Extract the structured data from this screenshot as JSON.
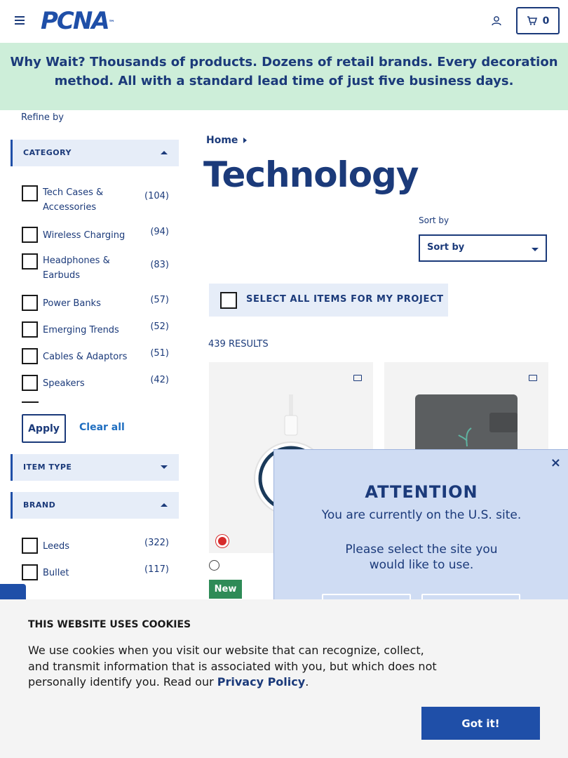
{
  "header": {
    "logo": "PCNA",
    "logo_mark": "™",
    "cart_count": "0"
  },
  "banner": {
    "lead": "Why Wait?",
    "text": " Thousands of products. Dozens of retail brands. Every decoration method. All with a standard lead time of just five business days."
  },
  "sidebar": {
    "refine_label": "Refine by",
    "category": {
      "title": "CATEGORY",
      "items": [
        {
          "label": "Tech Cases & Accessories",
          "count": "(104)"
        },
        {
          "label": "Wireless Charging",
          "count": "(94)"
        },
        {
          "label": "Headphones & Earbuds",
          "count": "(83)"
        },
        {
          "label": "Power Banks",
          "count": "(57)"
        },
        {
          "label": "Emerging Trends",
          "count": "(52)"
        },
        {
          "label": "Cables & Adaptors",
          "count": "(51)"
        },
        {
          "label": "Speakers",
          "count": "(42)"
        }
      ],
      "apply_label": "Apply",
      "clear_label": "Clear all"
    },
    "item_type": {
      "title": "ITEM TYPE"
    },
    "brand": {
      "title": "BRAND",
      "items": [
        {
          "label": "Leeds",
          "count": "(322)"
        },
        {
          "label": "Bullet",
          "count": "(117)"
        }
      ]
    }
  },
  "main": {
    "breadcrumb": "Home",
    "title": "Technology",
    "sort_label": "Sort by",
    "sort_value": "Sort by",
    "select_all_label": "SELECT ALL ITEMS FOR MY PROJECT",
    "results": "439 RESULTS",
    "new_badge": "New"
  },
  "modal": {
    "close": "×",
    "title": "ATTENTION",
    "line1": "You are currently on the U.S. site.",
    "line2": "Please select the site you",
    "line3": "would like to use."
  },
  "cookie": {
    "title": "THIS WEBSITE USES COOKIES",
    "text_before": "We use cookies when you visit our website that can recognize, collect, and transmit information that is associated with you, but which does not personally identify you. Read our ",
    "link": "Privacy Policy",
    "text_after": ".",
    "button": "Got it!"
  },
  "colors": {
    "brand_blue": "#1f4fa8",
    "navy": "#1b3a7a",
    "banner_green": "#cdeed9",
    "badge_green": "#2e8b57",
    "swatch_red": "#d62b2b"
  }
}
